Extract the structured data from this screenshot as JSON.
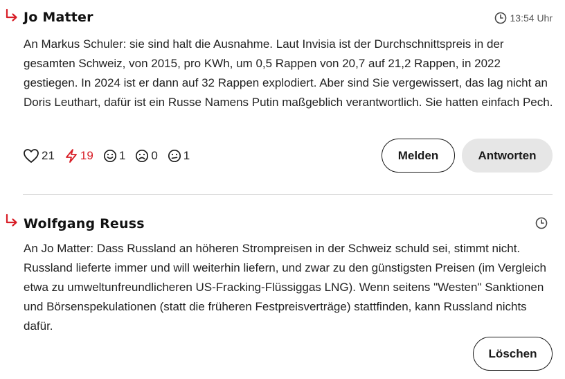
{
  "comments": [
    {
      "author": "Jo Matter",
      "time": "13:54 Uhr",
      "text": "An Markus Schuler: sie sind halt die Ausnahme. Laut Invisia ist der Durchschnittspreis in der gesamten Schweiz, von 2015, pro KWh, um 0,5 Rappen von 20,7 auf 21,2 Rappen, in 2022 gestiegen. In 2024 ist er dann auf 32 Rappen explodiert. Aber sind Sie vergewissert, das lag nicht an Doris Leuthart, dafür ist ein Russe Namens Putin maßgeblich verantwortlich. Sie hatten einfach Pech.",
      "reactions": [
        {
          "icon": "heart-icon",
          "count": "21"
        },
        {
          "icon": "lightning-icon",
          "count": "19",
          "color": "#d81e27"
        },
        {
          "icon": "smile-icon",
          "count": "1"
        },
        {
          "icon": "sad-icon",
          "count": "0"
        },
        {
          "icon": "neutral-icon",
          "count": "1"
        }
      ],
      "buttons": {
        "report": "Melden",
        "reply": "Antworten"
      }
    },
    {
      "author": "Wolfgang Reuss",
      "time": "",
      "text": "An Jo Matter: Dass Russland an höheren Strompreisen in der Schweiz schuld sei, stimmt nicht. Russland lieferte immer und will weiterhin liefern, und zwar zu den günstigsten Preisen (im Vergleich etwa zu umweltunfreundlicheren US-Fracking-Flüssiggas LNG). Wenn seitens \"Westen\" Sanktionen und Börsenspekulationen (statt die früheren Festpreisverträge) stattfinden, kann Russland nichts dafür.",
      "buttons": {
        "delete": "Löschen"
      }
    }
  ],
  "colors": {
    "accent": "#d81e27",
    "button_fill": "#e6e6e6",
    "divider": "#d6d6d6"
  }
}
